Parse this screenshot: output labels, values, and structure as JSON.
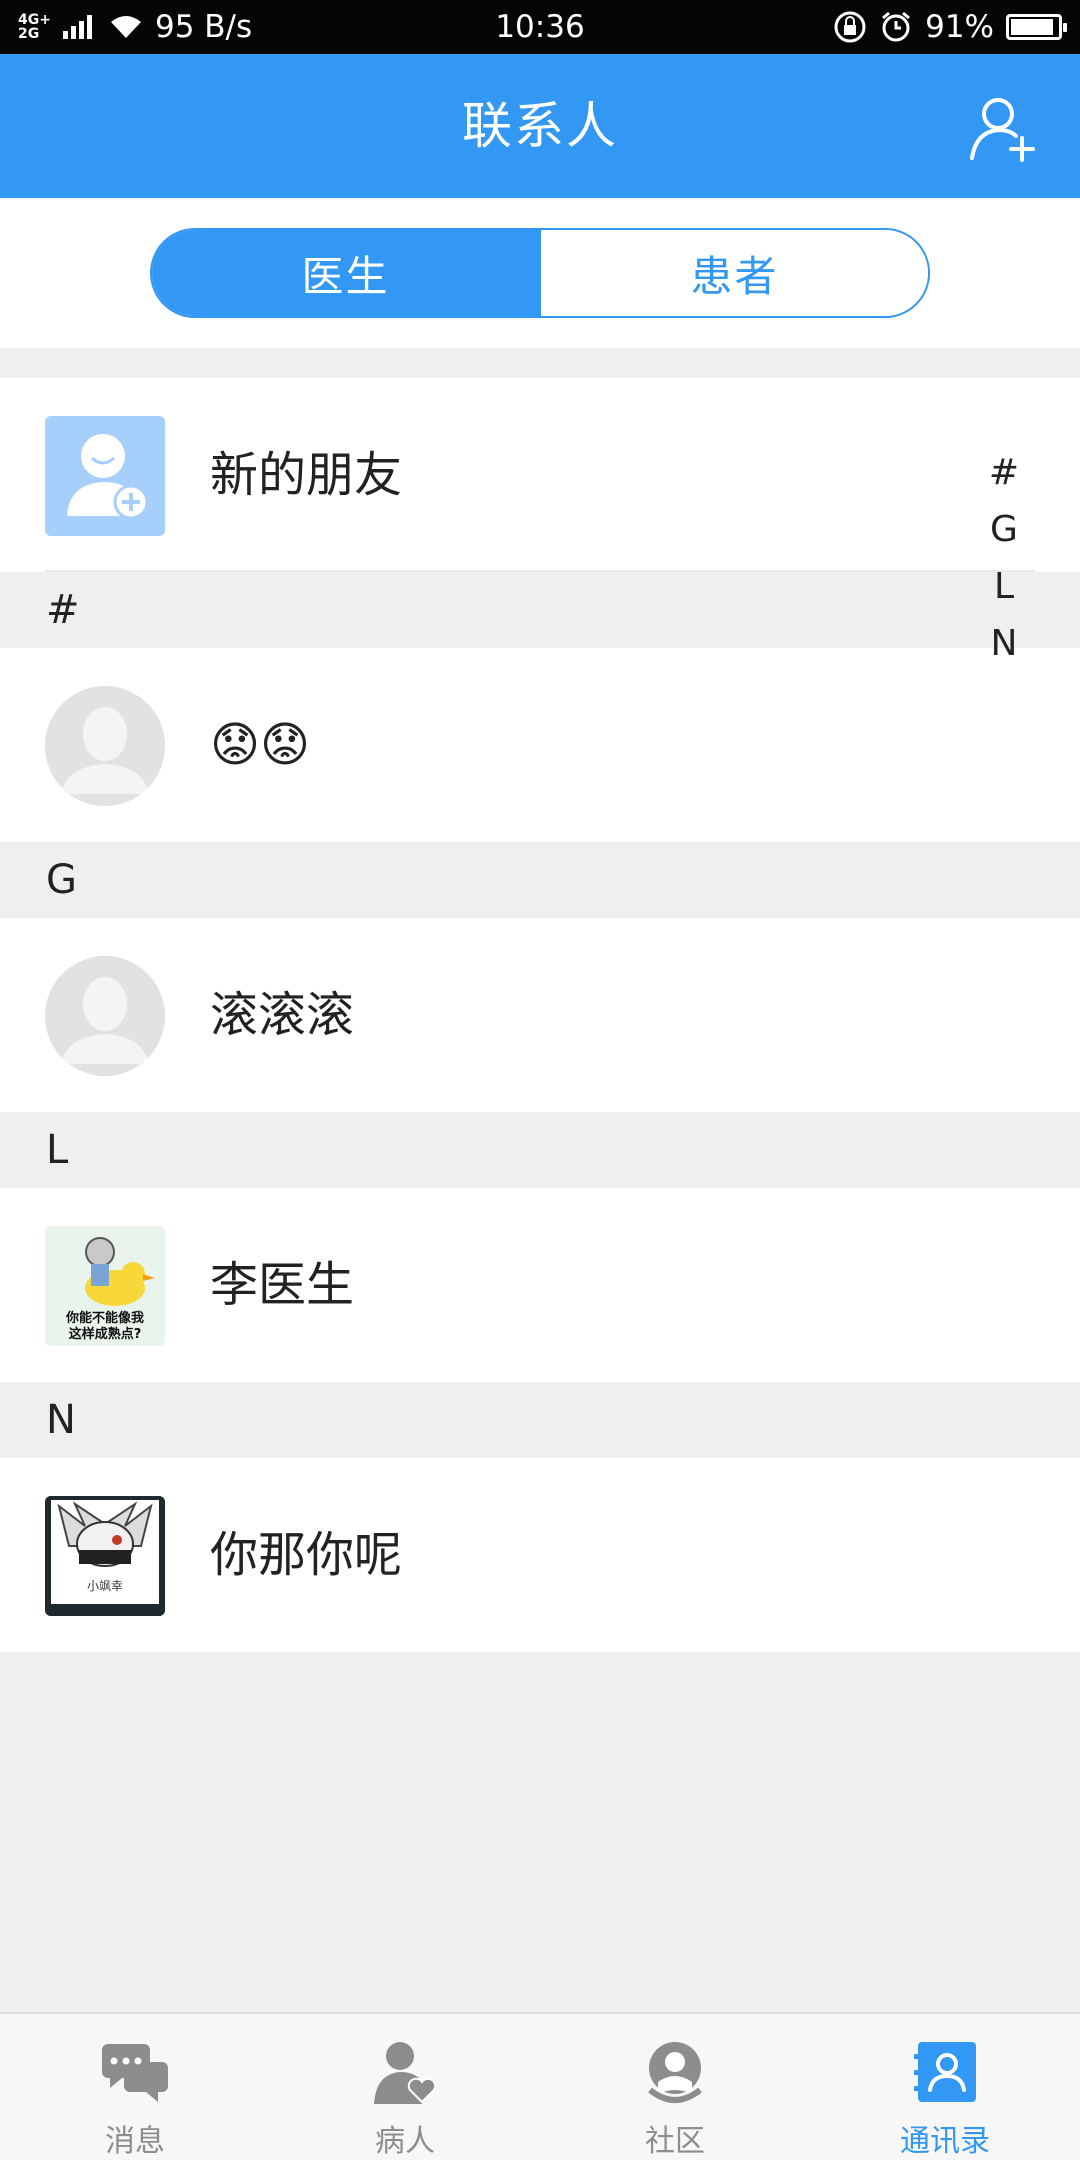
{
  "status_bar": {
    "network": [
      "4G+",
      "2G"
    ],
    "speed": "95 B/s",
    "time": "10:36",
    "battery": "91%",
    "battery_level": 0.91
  },
  "header": {
    "title": "联系人",
    "add_icon": "add-user-icon"
  },
  "segments": {
    "doctors": "医生",
    "patients": "患者",
    "active": "doctors"
  },
  "new_friends": {
    "label": "新的朋友",
    "icon": "add-friend-icon"
  },
  "sections": [
    {
      "letter": "#",
      "contacts": [
        {
          "name": "😟😟",
          "avatar": "default-avatar"
        }
      ]
    },
    {
      "letter": "G",
      "contacts": [
        {
          "name": "滚滚滚",
          "avatar": "default-avatar"
        }
      ]
    },
    {
      "letter": "L",
      "contacts": [
        {
          "name": "李医生",
          "avatar": "meme-avatar",
          "avatar_caption": "你能不能像我\n这样成熟点?"
        }
      ]
    },
    {
      "letter": "N",
      "contacts": [
        {
          "name": "你那你呢",
          "avatar": "anime-avatar",
          "avatar_caption": "小飒幸"
        }
      ]
    }
  ],
  "index_bar": [
    "#",
    "G",
    "L",
    "N"
  ],
  "bottom_nav": [
    {
      "label": "消息",
      "icon": "chat-bubbles-icon",
      "active": false
    },
    {
      "label": "病人",
      "icon": "patient-heart-icon",
      "active": false
    },
    {
      "label": "社区",
      "icon": "community-icon",
      "active": false
    },
    {
      "label": "通讯录",
      "icon": "contacts-book-icon",
      "active": true
    }
  ],
  "colors": {
    "primary": "#3398f3",
    "background": "#efefef",
    "inactive_nav": "#8d8d8d"
  }
}
